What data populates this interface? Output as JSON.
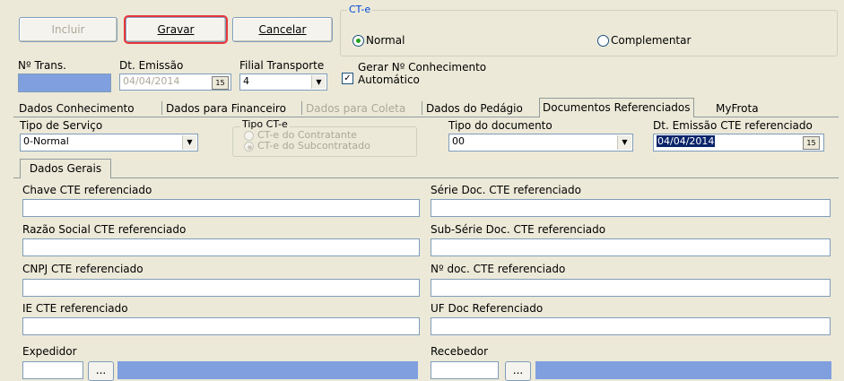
{
  "toolbar": {
    "incluir": "Incluir",
    "gravar": "Gravar",
    "cancelar": "Cancelar"
  },
  "cte": {
    "title": "CT-e",
    "normal": "Normal",
    "complementar": "Complementar"
  },
  "header_fields": {
    "ntrans_label": "Nº Trans.",
    "dt_emissao_label": "Dt. Emissão",
    "dt_emissao_value": "04/04/2014",
    "filial_label": "Filial Transporte",
    "filial_value": "4",
    "gerar_line1": "Gerar Nº Conhecimento",
    "gerar_line2": "Automático",
    "cal_icon": "15"
  },
  "tabs": [
    "Dados Conhecimento",
    "Dados para Financeiro",
    "Dados para Coleta",
    "Dados do Pedágio",
    "Documentos Referenciados",
    "MyFrota"
  ],
  "docref": {
    "tipo_servico_label": "Tipo de Serviço",
    "tipo_servico_value": "0-Normal",
    "tipo_cte_label": "Tipo CT-e",
    "tipo_cte_opt1": "CT-e do Contratante",
    "tipo_cte_opt2": "CT-e do Subcontratado",
    "tipo_doc_label": "Tipo do documento",
    "tipo_doc_value": "00",
    "dt_emissao_ref_label": "Dt. Emissão CTE referenciado",
    "dt_emissao_ref_value": "04/04/2014",
    "subtab": "Dados Gerais"
  },
  "form": {
    "chave_label": "Chave CTE referenciado",
    "serie_label": "Série Doc. CTE referenciado",
    "razao_label": "Razão Social CTE referenciado",
    "subserie_label": "Sub-Série Doc. CTE referenciado",
    "cnpj_label": "CNPJ CTE referenciado",
    "cnpj_value": " .   .   /   -",
    "ndoc_label": "Nº doc. CTE referenciado",
    "ie_label": "IE CTE referenciado",
    "uf_label": "UF Doc Referenciado",
    "expedidor_label": "Expedidor",
    "recebedor_label": "Recebedor",
    "ellipsis": "..."
  },
  "colors": {
    "focus_border": "#e8353a",
    "radio_check": "#21a121",
    "selection": "#0a246a",
    "blue_field": "#7f9fdf"
  }
}
